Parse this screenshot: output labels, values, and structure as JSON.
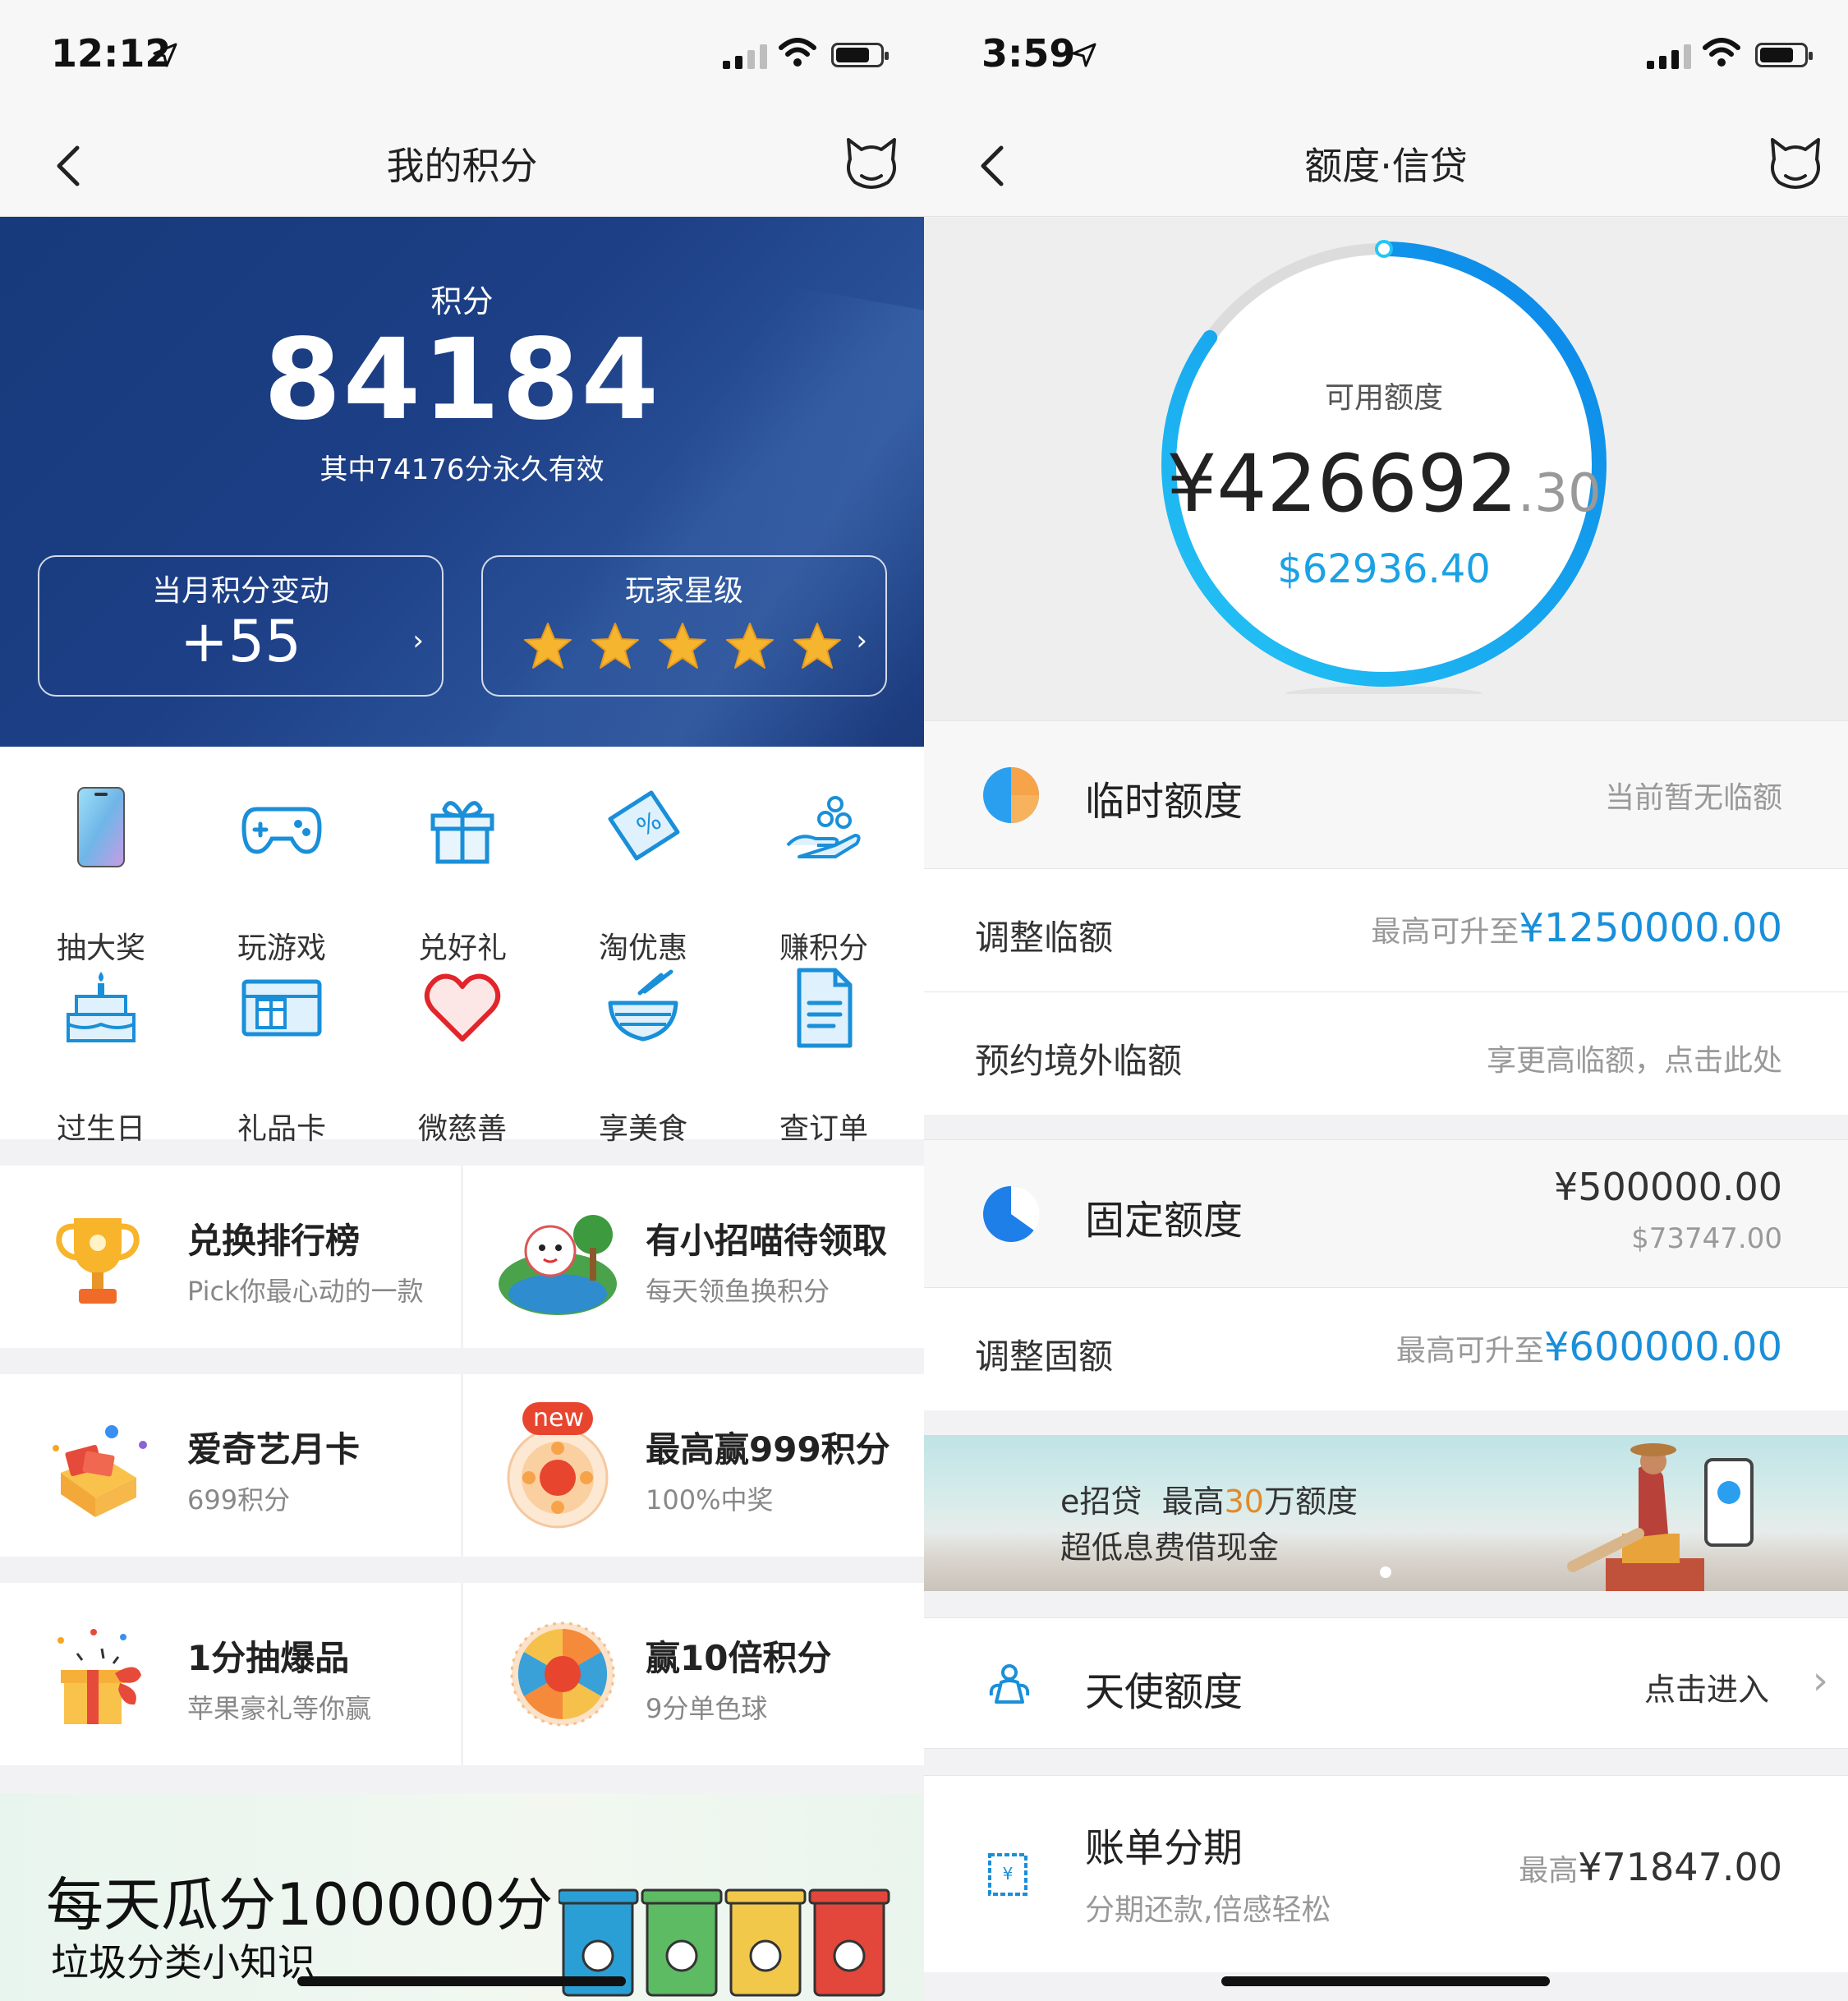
{
  "left": {
    "status": {
      "time": "12:12"
    },
    "nav": {
      "title": "我的积分"
    },
    "hero": {
      "label": "积分",
      "points": "84184",
      "sub": "其中74176分永久有效",
      "monthly": {
        "label": "当月积分变动",
        "value": "+55"
      },
      "stars": {
        "label": "玩家星级",
        "count": 5
      }
    },
    "grid": [
      {
        "label": "抽大奖",
        "icon": "phone-icon"
      },
      {
        "label": "玩游戏",
        "icon": "gamepad-icon"
      },
      {
        "label": "兑好礼",
        "icon": "gift-icon"
      },
      {
        "label": "淘优惠",
        "icon": "coupon-icon"
      },
      {
        "label": "赚积分",
        "icon": "coins-hand-icon"
      },
      {
        "label": "过生日",
        "icon": "cake-icon"
      },
      {
        "label": "礼品卡",
        "icon": "gift-card-icon"
      },
      {
        "label": "微慈善",
        "icon": "heart-icon"
      },
      {
        "label": "享美食",
        "icon": "food-bowl-icon"
      },
      {
        "label": "查订单",
        "icon": "document-icon"
      }
    ],
    "promos": [
      {
        "title": "兑换排行榜",
        "sub": "Pick你最心动的一款",
        "icon": "trophy-icon"
      },
      {
        "title": "有小招喵待领取",
        "sub": "每天领鱼换积分",
        "icon": "cat-island-icon"
      },
      {
        "title": "爱奇艺月卡",
        "sub": "699积分",
        "icon": "gift-box-icon"
      },
      {
        "title": "最高赢999积分",
        "sub": "100%中奖",
        "icon": "lucky-wheel-icon",
        "badge": "new"
      },
      {
        "title": "1分抽爆品",
        "sub": "苹果豪礼等你赢",
        "icon": "prize-box-icon"
      },
      {
        "title": "赢10倍积分",
        "sub": "9分单色球",
        "icon": "color-wheel-icon"
      }
    ],
    "banner": {
      "line1": "每天瓜分100000分",
      "line2": "垃圾分类小知识"
    }
  },
  "right": {
    "status": {
      "time": "3:59"
    },
    "nav": {
      "title": "额度·信贷"
    },
    "gauge": {
      "label": "可用额度",
      "amount_main": "¥426692",
      "amount_decimal": ".30",
      "usd": "$62936.40",
      "fraction": 0.85
    },
    "temp": {
      "title": "临时额度",
      "status": "当前暂无临额",
      "rows": [
        {
          "label": "调整临额",
          "prefix": "最高可升至",
          "value": "¥1250000.00"
        },
        {
          "label": "预约境外临额",
          "text": "享更高临额，点击此处"
        }
      ]
    },
    "fixed": {
      "title": "固定额度",
      "amount": "¥500000.00",
      "usd": "$73747.00",
      "rows": [
        {
          "label": "调整固额",
          "prefix": "最高可升至",
          "value": "¥600000.00"
        }
      ]
    },
    "ebanner": {
      "brand": "e招贷",
      "line1_prefix": "最高",
      "line1_hl": "30",
      "line1_suffix": "万额度",
      "line2": "超低息费借现金"
    },
    "angel": {
      "title": "天使额度",
      "action": "点击进入"
    },
    "installment": {
      "title": "账单分期",
      "sub": "分期还款,倍感轻松",
      "prefix": "最高",
      "value": "¥71847.00"
    }
  }
}
